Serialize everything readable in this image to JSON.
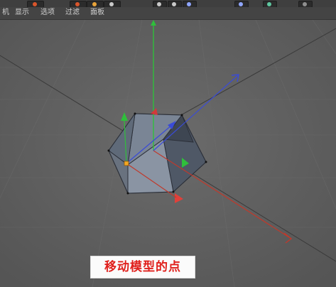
{
  "menu": {
    "items": [
      {
        "label": "机"
      },
      {
        "label": "显示"
      },
      {
        "label": "选项"
      },
      {
        "label": "过滤"
      },
      {
        "label": "面板"
      }
    ]
  },
  "toolbar": {
    "button_dot_colors": [
      "#d9552b",
      "#d9552b",
      "#e8a33a",
      "#c9c9c9",
      "#c9c9c9",
      "#c9c9c9",
      "#8fa6ff",
      "#8fa6ff",
      "#5fc7a0",
      "#8f8f8f"
    ]
  },
  "viewport": {
    "axis_colors": {
      "x": "#c0392b",
      "y": "#2fbf3b",
      "z": "#3a4bd6"
    },
    "model_face_color": "#6d7888",
    "point_highlight_color": "#f5a623"
  },
  "caption": {
    "text": "移动模型的点"
  }
}
